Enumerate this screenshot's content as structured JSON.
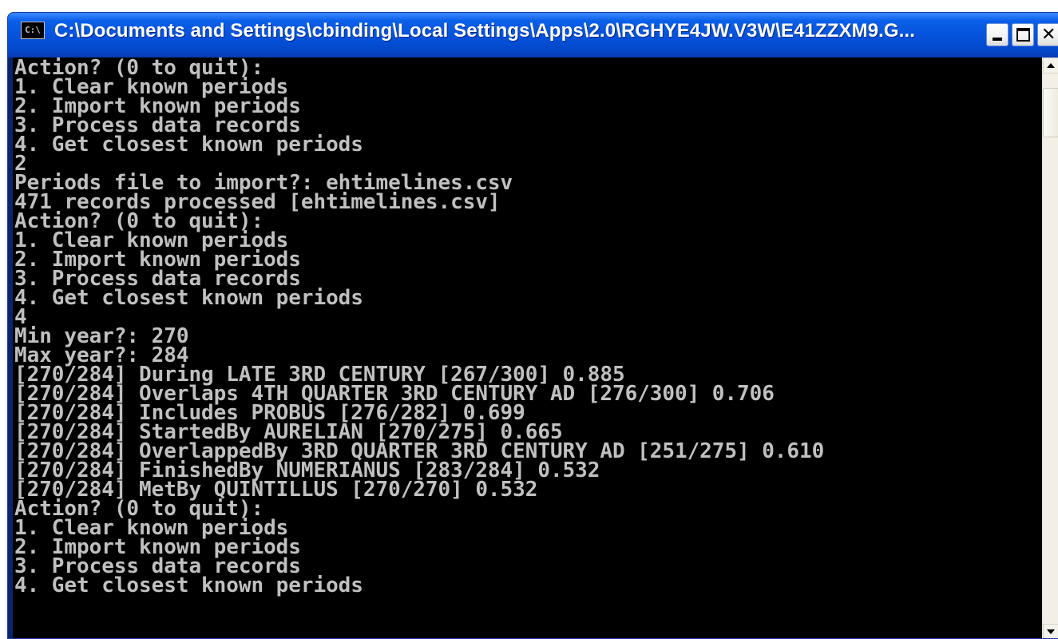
{
  "window": {
    "title": "C:\\Documents and Settings\\cbinding\\Local Settings\\Apps\\2.0\\RGHYE4JW.V3W\\E41ZZXM9.G...",
    "icon_label": "C:\\",
    "controls": {
      "minimize_icon": "minimize-icon",
      "maximize_icon": "maximize-icon",
      "close_glyph": "✕"
    }
  },
  "console": {
    "lines": [
      "Action? (0 to quit):",
      "1. Clear known periods",
      "2. Import known periods",
      "3. Process data records",
      "4. Get closest known periods",
      "2",
      "Periods file to import?: ehtimelines.csv",
      "471 records processed [ehtimelines.csv]",
      "Action? (0 to quit):",
      "1. Clear known periods",
      "2. Import known periods",
      "3. Process data records",
      "4. Get closest known periods",
      "4",
      "Min year?: 270",
      "Max year?: 284",
      "[270/284] During LATE 3RD CENTURY [267/300] 0.885",
      "[270/284] Overlaps 4TH QUARTER 3RD CENTURY AD [276/300] 0.706",
      "[270/284] Includes PROBUS [276/282] 0.699",
      "[270/284] StartedBy AURELIAN [270/275] 0.665",
      "[270/284] OverlappedBy 3RD QUARTER 3RD CENTURY AD [251/275] 0.610",
      "[270/284] FinishedBy NUMERIANUS [283/284] 0.532",
      "[270/284] MetBy QUINTILLUS [270/270] 0.532",
      "Action? (0 to quit):",
      "1. Clear known periods",
      "2. Import known periods",
      "3. Process data records",
      "4. Get closest known periods"
    ],
    "text_color": "#c0c0c0",
    "background_color": "#000000"
  },
  "scrollbar": {
    "up_icon": "scroll-up-arrow-icon",
    "down_icon": "scroll-down-arrow-icon"
  }
}
